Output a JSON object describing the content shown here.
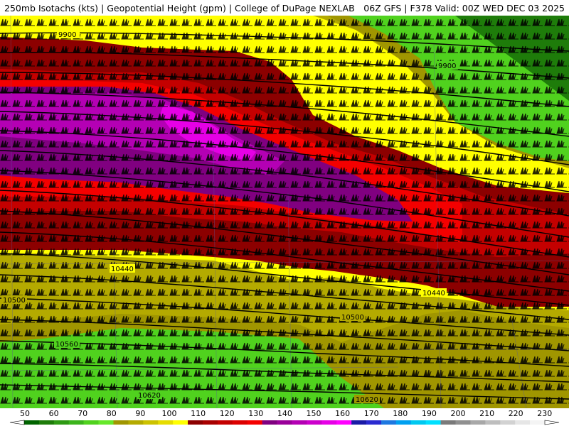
{
  "title": {
    "left": "250mb Isotachs (kts) | Geopotential Height (gpm) | College of DuPage NEXLAB",
    "right": "06Z GFS | F378 Valid: 00Z WED DEC 03 2025"
  },
  "contours": [
    {
      "label": "9900"
    },
    {
      "label": "9900"
    },
    {
      "label": "10440"
    },
    {
      "label": "10440"
    },
    {
      "label": "10500"
    },
    {
      "label": "10500"
    },
    {
      "label": "10560"
    },
    {
      "label": "10620"
    },
    {
      "label": "10620"
    }
  ],
  "colorbar": {
    "ticks": [
      "50",
      "60",
      "70",
      "80",
      "90",
      "100",
      "110",
      "120",
      "130",
      "140",
      "150",
      "160",
      "170",
      "180",
      "190",
      "200",
      "210",
      "220",
      "230"
    ],
    "colors": [
      "#006400",
      "#1e7c0a",
      "#2e9a14",
      "#3cb41c",
      "#50d21e",
      "#66e82a",
      "#a09600",
      "#b4aa00",
      "#ccc200",
      "#e6dc00",
      "#ffff00",
      "#8c0000",
      "#a80000",
      "#c40000",
      "#dc0000",
      "#f40000",
      "#800080",
      "#9a009a",
      "#b400b4",
      "#cc00cc",
      "#e600e6",
      "#ff00ff",
      "#1a1aa6",
      "#2a2ad0",
      "#1e78e0",
      "#00a0f0",
      "#00c8f0",
      "#00e0ff",
      "#7a7a7a",
      "#909090",
      "#a8a8a8",
      "#bebebe",
      "#d2d2d2",
      "#e6e6e6",
      "#f4f4f4"
    ]
  }
}
